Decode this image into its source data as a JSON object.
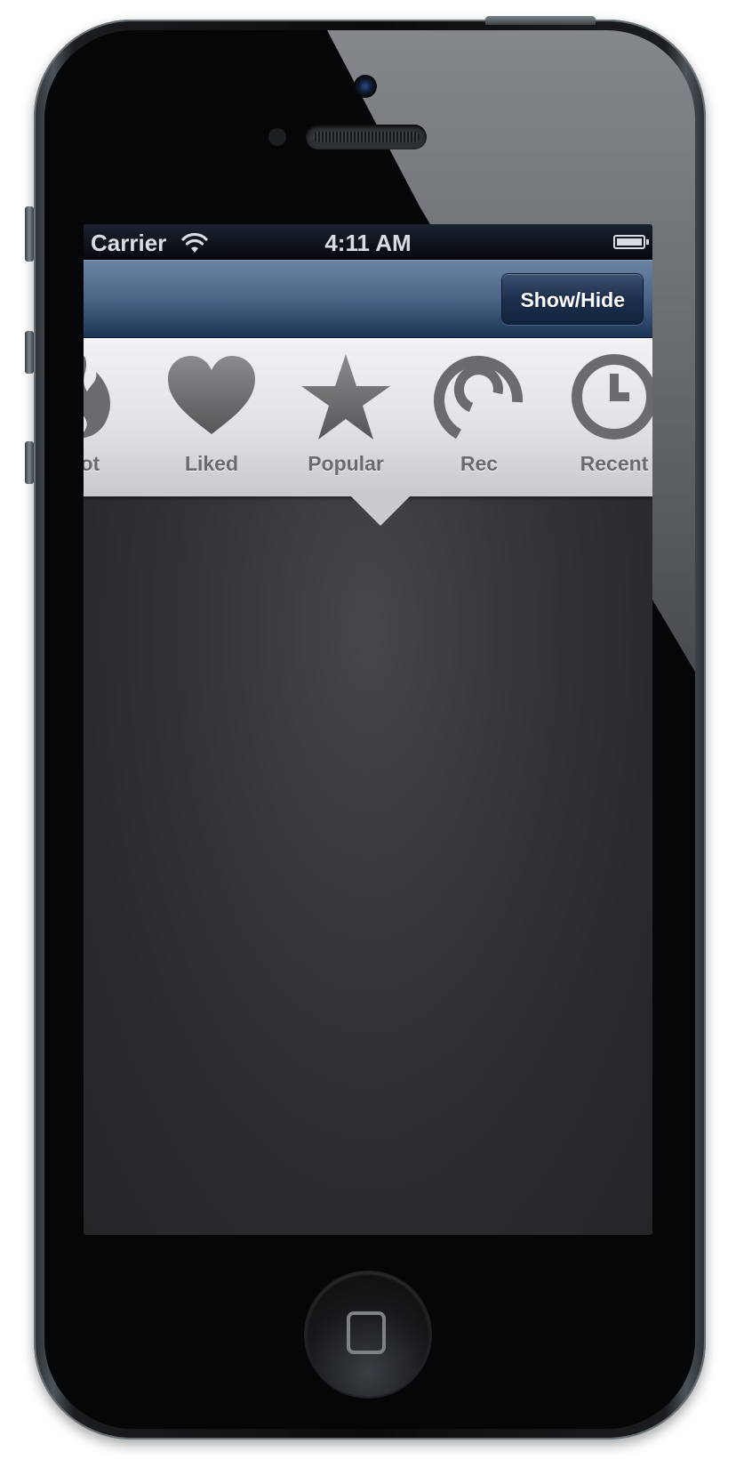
{
  "status_bar": {
    "carrier": "Carrier",
    "time": "4:11 AM",
    "wifi_icon": "wifi-icon",
    "battery_icon": "battery-icon"
  },
  "nav_bar": {
    "show_hide_label": "Show/Hide"
  },
  "tabs": [
    {
      "label": "Hot",
      "icon": "flame-icon",
      "selected": false
    },
    {
      "label": "Liked",
      "icon": "heart-icon",
      "selected": false
    },
    {
      "label": "Popular",
      "icon": "star-icon",
      "selected": true
    },
    {
      "label": "Rec",
      "icon": "loading-arc-icon",
      "selected": false
    },
    {
      "label": "Recent",
      "icon": "clock-icon",
      "selected": false
    }
  ],
  "colors": {
    "nav_bar": "#2b4466",
    "tab_strip": "#e0e2e6",
    "icon_fill": "#6a6b6e",
    "content_bg": "#35373b"
  }
}
